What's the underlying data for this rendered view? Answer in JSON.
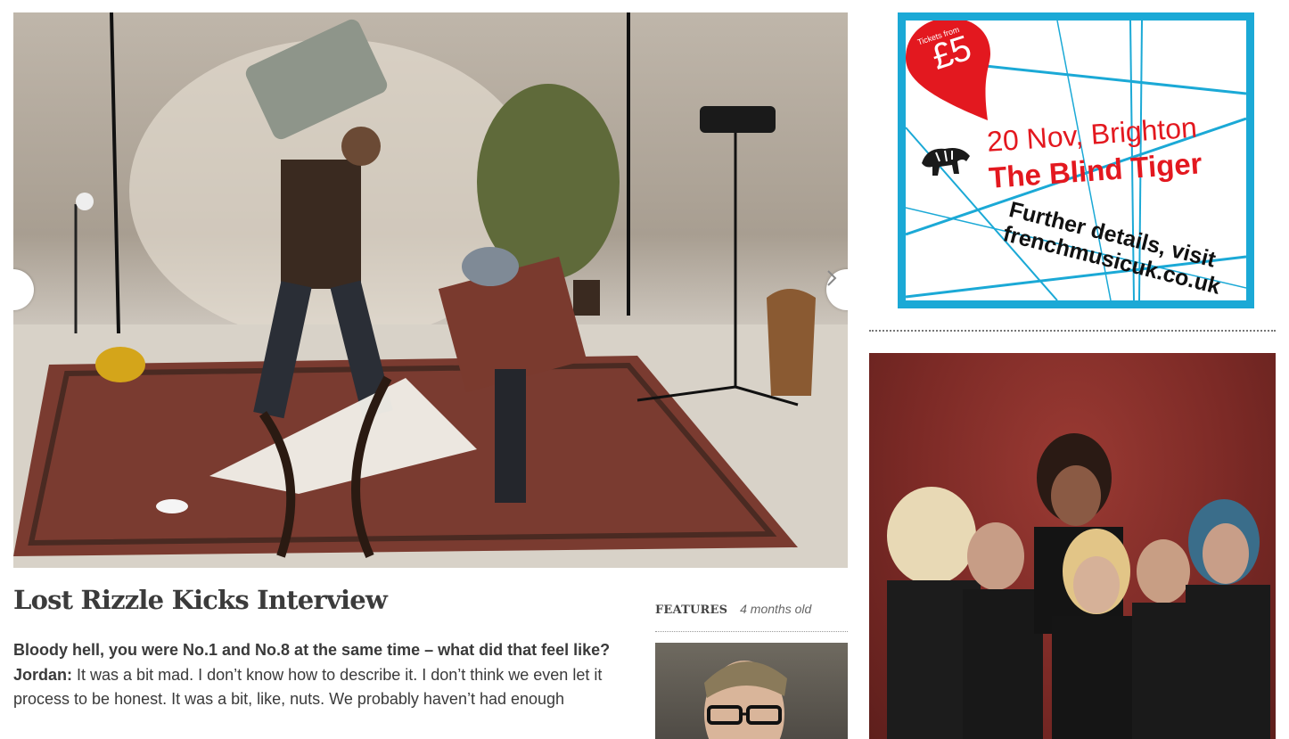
{
  "hero": {
    "prev_icon": "chevron-left-icon",
    "next_icon": "chevron-right-icon"
  },
  "article": {
    "title": "Lost Rizzle Kicks Interview",
    "question": "Bloody hell, you were No.1 and No.8 at the same time – what did that feel like?",
    "speaker": "Jordan:",
    "answer": "It was a bit mad. I don’t know how to describe it. I don’t think we even let it process to be honest. It was a bit, like, nuts. We probably haven’t had enough"
  },
  "feature": {
    "category": "FEATURES",
    "age": "4 months old"
  },
  "ad": {
    "pin_small": "Tickets from",
    "pin_price": "£5",
    "date": "20 Nov, Brighton",
    "venue": "The Blind Tiger",
    "details_line1": "Further details, visit",
    "details_line2": "frenchmusicuk.co.uk",
    "colors": {
      "border": "#1ba9d6",
      "red": "#e3181f"
    }
  }
}
